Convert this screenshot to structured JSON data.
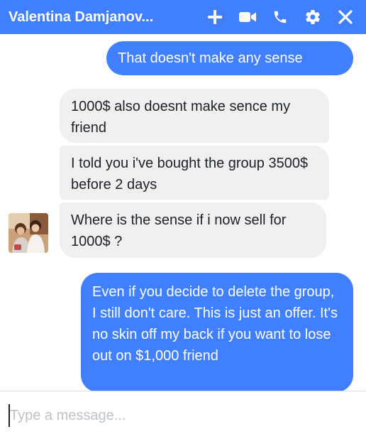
{
  "header": {
    "title": "Valentina Damjanov...",
    "icons": [
      "plus-icon",
      "video-camera-icon",
      "phone-icon",
      "gear-icon",
      "close-icon"
    ],
    "background": "#4080ff"
  },
  "messages": [
    {
      "direction": "outgoing",
      "text": "That doesn't make any sense"
    },
    {
      "direction": "incoming",
      "text": "1000$ also doesnt make sence my friend"
    },
    {
      "direction": "incoming",
      "text": "I told you i've bought the group 3500$ before 2 days"
    },
    {
      "direction": "incoming",
      "text": "Where is the sense if i now sell for 1000$ ?"
    },
    {
      "direction": "outgoing",
      "text": "Even if you decide to delete the group, I still don't care. This is just an offer. It's no skin off my back if you want to lose out on $1,000 friend"
    }
  ],
  "composer": {
    "placeholder": "Type a message..."
  },
  "colors": {
    "outgoing_bubble": "#4080ff",
    "incoming_bubble": "#f1f0f0"
  }
}
